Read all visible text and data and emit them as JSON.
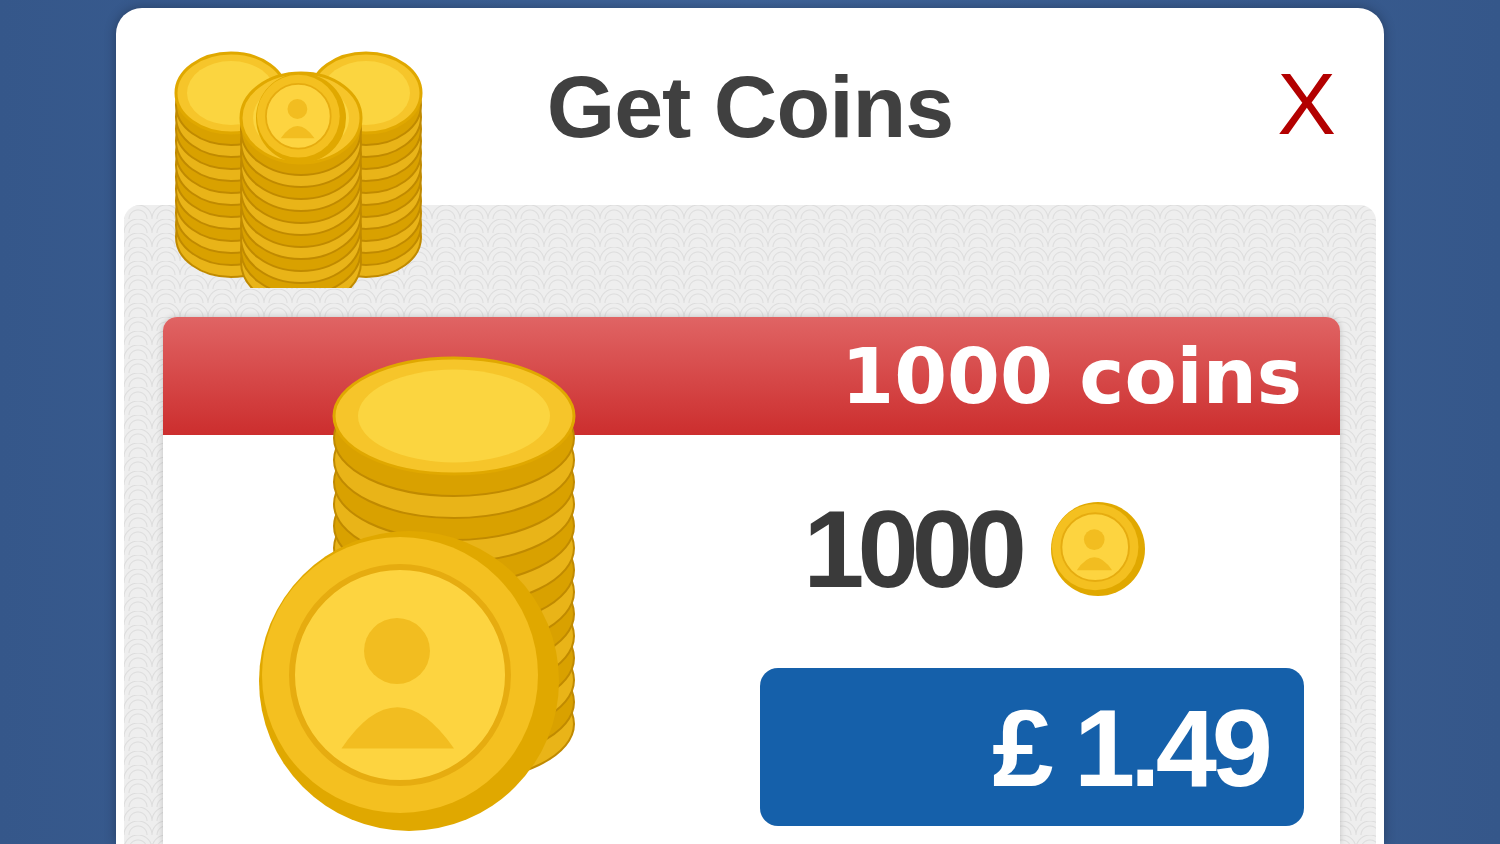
{
  "dialog": {
    "title": "Get Coins",
    "close": "X"
  },
  "offer": {
    "label": "1000 coins",
    "amount": "1000",
    "price": "£ 1.49"
  }
}
